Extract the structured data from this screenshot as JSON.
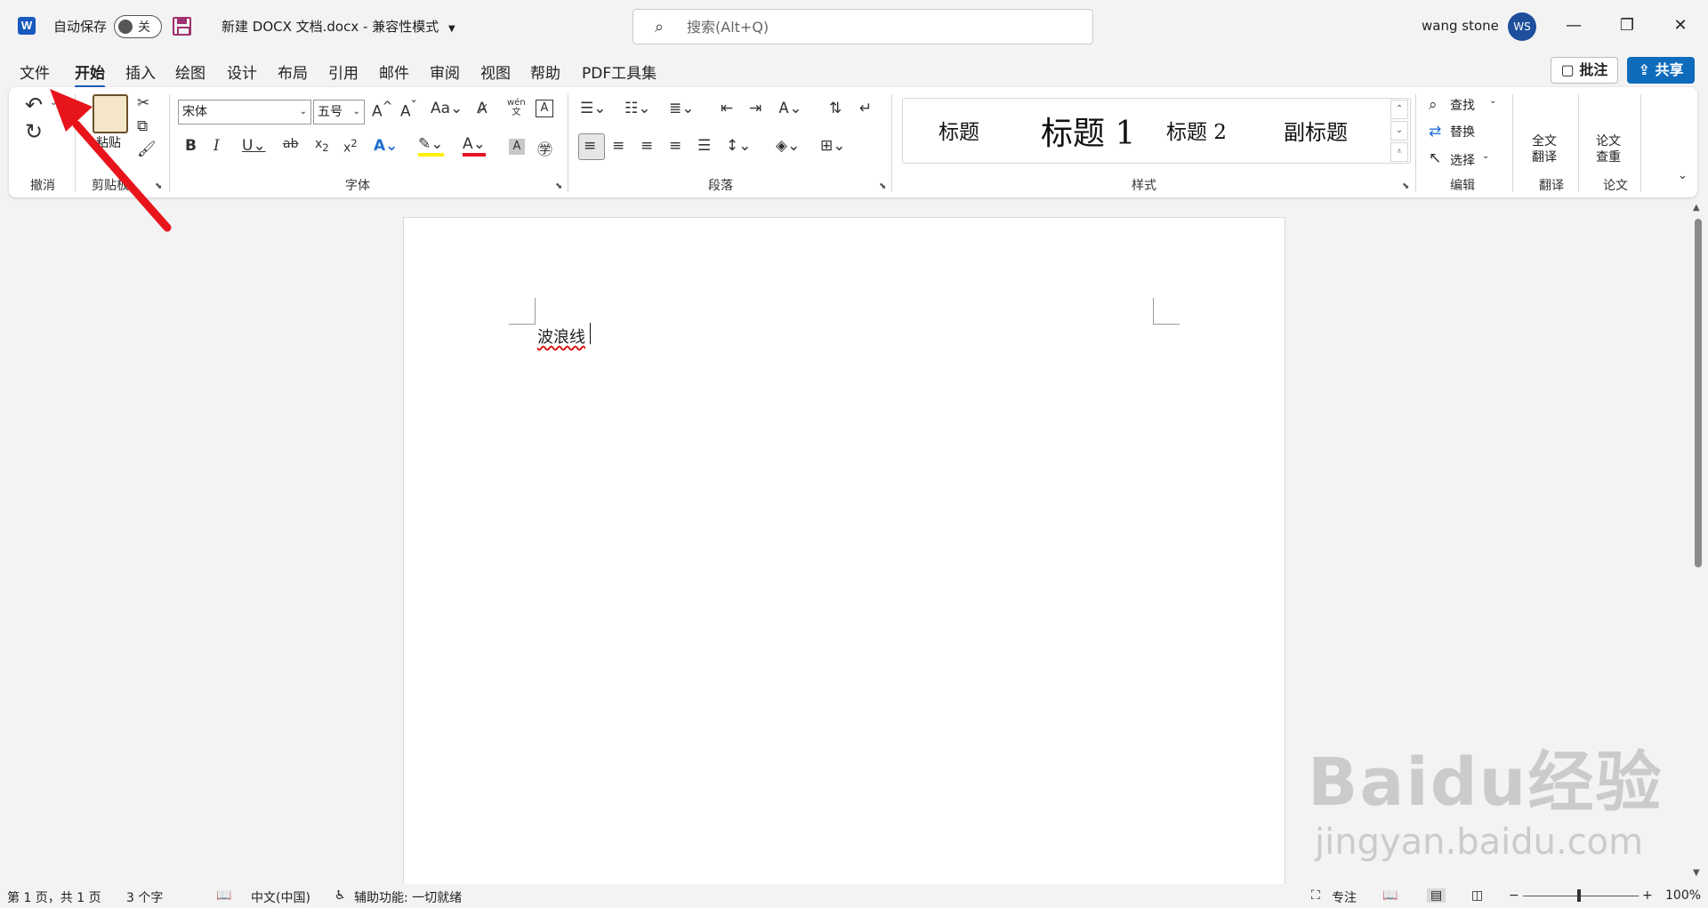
{
  "titlebar": {
    "app_logo": "W",
    "autosave_label": "自动保存",
    "autosave_state": "关",
    "doc_title": "新建 DOCX 文档.docx",
    "mode": "兼容性模式",
    "search_placeholder": "搜索(Alt+Q)",
    "user_name": "wang stone",
    "avatar_initials": "WS"
  },
  "tabs": [
    "文件",
    "开始",
    "插入",
    "绘图",
    "设计",
    "布局",
    "引用",
    "邮件",
    "审阅",
    "视图",
    "帮助",
    "PDF工具集"
  ],
  "active_tab": "开始",
  "actions": {
    "comment": "批注",
    "share": "共享"
  },
  "ribbon": {
    "undo_group": "撤消",
    "clipboard_group": "剪贴板",
    "paste_label": "粘贴",
    "font_group": "字体",
    "font_name": "宋体",
    "font_size": "五号",
    "paragraph_group": "段落",
    "styles_group": "样式",
    "styles": [
      "标题",
      "标题 1",
      "标题 2",
      "副标题"
    ],
    "editing_group": "编辑",
    "find": "查找",
    "replace": "替换",
    "select": "选择",
    "translate_group": "翻译",
    "translate_btn_1": "全文",
    "translate_btn_2": "翻译",
    "paper_group": "论文",
    "paper_btn_1": "论文",
    "paper_btn_2": "查重"
  },
  "document": {
    "text": "波浪线"
  },
  "status": {
    "page": "第 1 页，共 1 页",
    "words": "3 个字",
    "language": "中文(中国)",
    "accessibility": "辅助功能: 一切就绪",
    "focus": "专注",
    "zoom": "100%"
  },
  "watermark": {
    "brand": "Baidu经验",
    "url": "jingyan.baidu.com"
  },
  "colors": {
    "accent": "#185abd",
    "share": "#0f6cbd",
    "arrow": "#e8141b"
  }
}
